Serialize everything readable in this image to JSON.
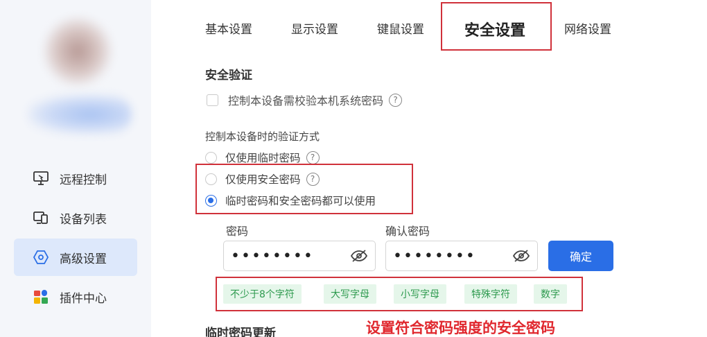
{
  "tabs": [
    {
      "label": "基本设置",
      "active": false
    },
    {
      "label": "显示设置",
      "active": false
    },
    {
      "label": "键鼠设置",
      "active": false
    },
    {
      "label": "安全设置",
      "active": true
    },
    {
      "label": "网络设置",
      "active": false
    }
  ],
  "sidebar": {
    "items": [
      {
        "label": "远程控制",
        "icon": "monitor-icon",
        "active": false
      },
      {
        "label": "设备列表",
        "icon": "devices-icon",
        "active": false
      },
      {
        "label": "高级设置",
        "icon": "hexagon-settings-icon",
        "active": true
      },
      {
        "label": "插件中心",
        "icon": "plugin-grid-icon",
        "active": false
      }
    ]
  },
  "security": {
    "section_title": "安全验证",
    "checkbox_label": "控制本设备需校验本机系统密码",
    "checkbox_checked": false,
    "help_glyph": "?",
    "auth_method_title": "控制本设备时的验证方式",
    "options": [
      {
        "label": "仅使用临时密码",
        "checked": false,
        "has_help": true
      },
      {
        "label": "仅使用安全密码",
        "checked": false,
        "has_help": true
      },
      {
        "label": "临时密码和安全密码都可以使用",
        "checked": true,
        "has_help": false
      }
    ],
    "password_label": "密码",
    "password_value": "••••••••",
    "confirm_password_label": "确认密码",
    "confirm_password_value": "••••••••",
    "confirm_button": "确定",
    "rules": [
      "不少于8个字符",
      "大写字母",
      "小写字母",
      "特殊字符",
      "数字"
    ],
    "temp_password_title": "临时密码更新"
  },
  "annotation": "设置符合密码强度的安全密码",
  "colors": {
    "accent": "#2a6ee6",
    "highlight_box": "#d0313a",
    "annotation_text": "#e0282e",
    "rule_bg": "#e5f6ea",
    "rule_text": "#2e9a4f",
    "sidebar_bg": "#f4f6fa",
    "sidebar_active_bg": "#dde8fb"
  }
}
